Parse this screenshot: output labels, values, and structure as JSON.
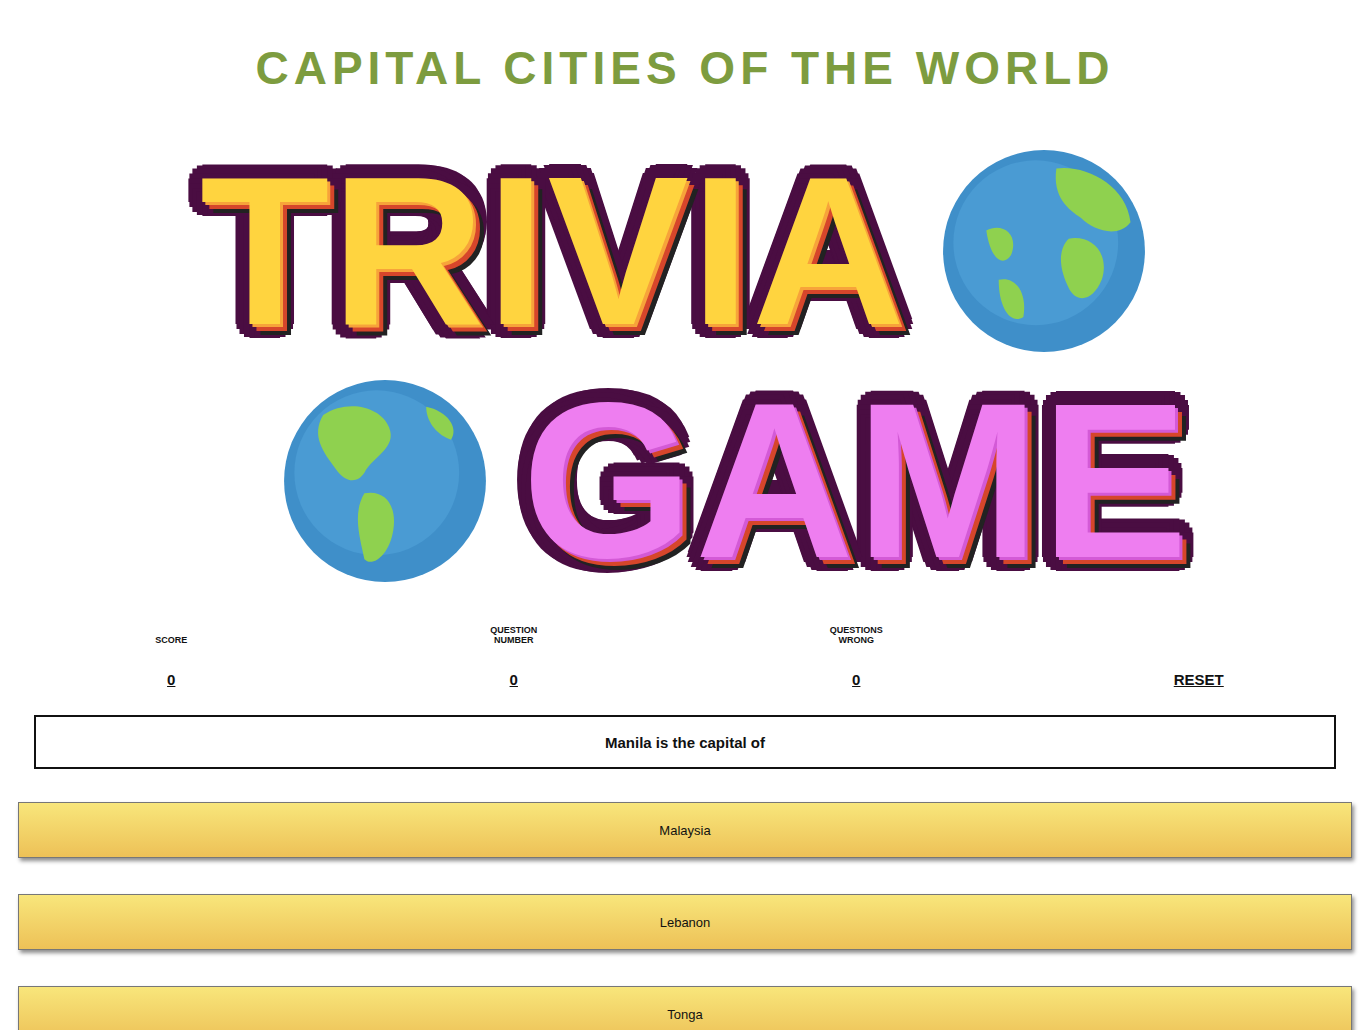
{
  "header": {
    "title": "CAPITAL CITIES OF THE WORLD"
  },
  "logo": {
    "line1": "TRIVIA",
    "line2": "GAME"
  },
  "stats": [
    {
      "label": "SCORE",
      "value": "0"
    },
    {
      "label": "QUESTION NUMBER",
      "value": "0"
    },
    {
      "label": "QUESTIONS WRONG",
      "value": "0"
    }
  ],
  "reset": "RESET",
  "question": "Manila is the capital of",
  "answers": [
    {
      "label": "Malaysia"
    },
    {
      "label": "Lebanon"
    },
    {
      "label": "Tonga"
    }
  ]
}
